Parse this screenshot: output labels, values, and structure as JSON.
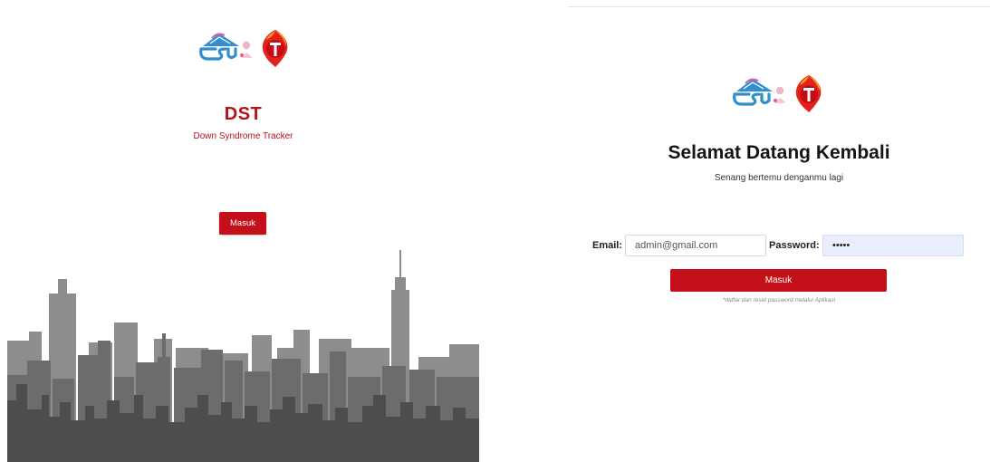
{
  "splash": {
    "title": "DST",
    "subtitle": "Down Syndrome Tracker",
    "login_button": "Masuk"
  },
  "login": {
    "title": "Selamat Datang Kembali",
    "subtitle": "Senang bertemu denganmu lagi",
    "email_label": "Email:",
    "email_value": "admin@gmail.com",
    "password_label": "Password:",
    "password_value": "•••••",
    "submit_button": "Masuk",
    "note": "*daftar dan reset password melalui Aplikasi"
  },
  "brand": {
    "logos": [
      "dsc-logo-icon",
      "t-shield-logo-icon"
    ],
    "accent_color": "#c4101a",
    "title_color": "#b3121b",
    "skyline_colors": [
      "#8d8d8d",
      "#6c6c6c",
      "#4d4d4d"
    ],
    "input_autofill_color": "#e8eefc"
  }
}
